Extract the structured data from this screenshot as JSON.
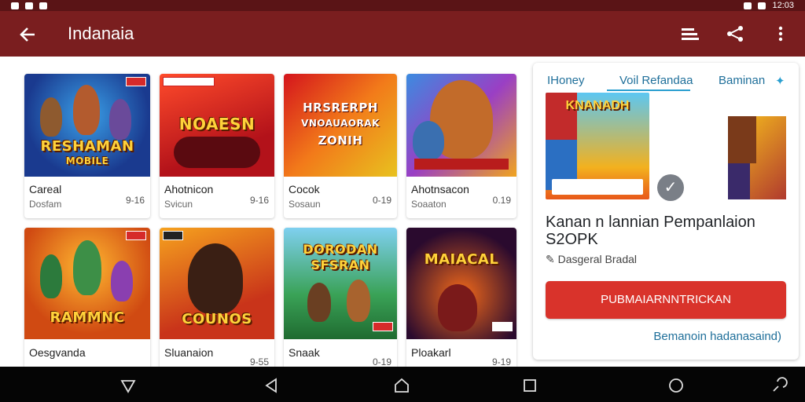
{
  "status": {
    "time": "12:03"
  },
  "appbar": {
    "title": "Indanaia",
    "back_icon": "arrow-left-icon",
    "actions": [
      "sort-icon",
      "share-icon",
      "more-vert-icon"
    ]
  },
  "colors": {
    "appbar": "#7a1e1f",
    "statusbar": "#5a1416",
    "button": "#d9332b",
    "link": "#1f6f9a"
  },
  "grid": [
    {
      "thumb_text": [
        "RESHAMAN",
        "MOBILE"
      ],
      "name": "Careal",
      "sub": "Dosfam",
      "rating": "9-16"
    },
    {
      "thumb_text": [
        "NOAESN"
      ],
      "name": "Ahotnicon",
      "sub": "Svicun",
      "rating": "9-16"
    },
    {
      "thumb_text": [
        "HRSRERPH",
        "VNOAUAORAK",
        "ZONIH"
      ],
      "name": "Cocok",
      "sub": "Sosaun",
      "rating": "0-19"
    },
    {
      "thumb_text": [],
      "name": "Ahotnsacon",
      "sub": "Soaaton",
      "rating": "0.19"
    },
    {
      "thumb_text": [
        "RAMMNC"
      ],
      "name": "Oesgvanda",
      "sub": "",
      "rating": ""
    },
    {
      "thumb_text": [
        "COUNOS"
      ],
      "name": "Sluanaion",
      "sub": "",
      "rating": "9-55"
    },
    {
      "thumb_text": [
        "DORODAN",
        "SFSRAN"
      ],
      "name": "Snaak",
      "sub": "",
      "rating": "0-19"
    },
    {
      "thumb_text": [
        "MAIACAL"
      ],
      "name": "Ploakarl",
      "sub": "",
      "rating": "9-19"
    }
  ],
  "panel": {
    "tabs": [
      "IHoney",
      "Voil Refandaa",
      "Baminan"
    ],
    "selected_tab": 1,
    "image_text": "KNANADH",
    "title": "Kanan n lannian Pempanlaion S2OPK",
    "author": "Dasgeral Bradal",
    "primary_button": "PUBMAIARNNTRICKAN",
    "link": "Bemanoin hadanasaind"
  },
  "navbar": [
    "back-triangle-icon",
    "back-icon",
    "home-icon",
    "recents-icon",
    "circle-icon",
    "assistant-icon"
  ]
}
